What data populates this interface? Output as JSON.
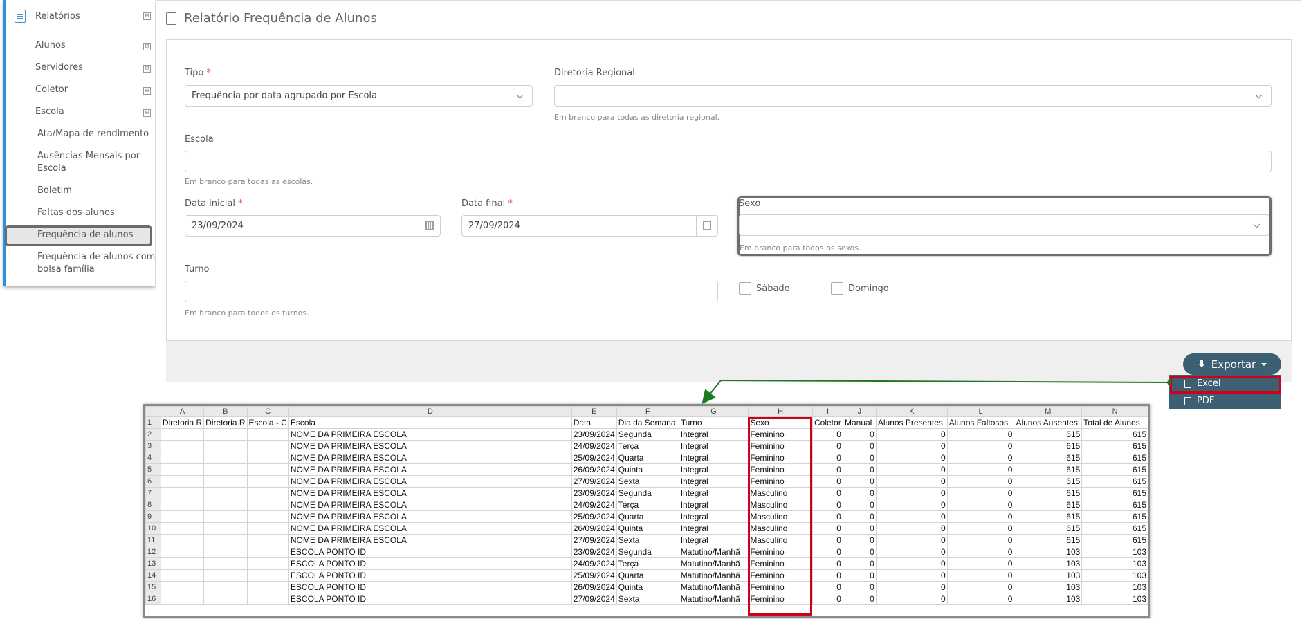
{
  "sidebar": {
    "title": "Relatórios",
    "items": [
      {
        "label": "Alunos",
        "toggle": "⊞"
      },
      {
        "label": "Servidores",
        "toggle": "⊞"
      },
      {
        "label": "Coletor",
        "toggle": "⊞"
      },
      {
        "label": "Escola",
        "toggle": "⊟"
      }
    ],
    "subitems": [
      "Ata/Mapa de rendimento",
      "Ausências Mensais por Escola",
      "Boletim",
      "Faltas dos alunos",
      "Frequência de alunos",
      "Frequência de alunos com bolsa família"
    ],
    "head_toggle": "⊟"
  },
  "page": {
    "title": "Relatório Frequência de Alunos"
  },
  "form": {
    "tipo_label": "Tipo",
    "tipo_value": "Frequência por data agrupado por Escola",
    "diretoria_label": "Diretoria Regional",
    "diretoria_hint": "Em branco para todas as diretoria regional.",
    "escola_label": "Escola",
    "escola_hint": "Em branco para todas as escolas.",
    "data_inicial_label": "Data inicial",
    "data_inicial_value": "23/09/2024",
    "data_final_label": "Data final",
    "data_final_value": "27/09/2024",
    "sexo_label": "Sexo",
    "sexo_hint": "Em branco para todos os sexos.",
    "turno_label": "Turno",
    "turno_hint": "Em branco para todos os turnos.",
    "sabado_label": "Sábado",
    "domingo_label": "Domingo",
    "required_mark": "*"
  },
  "export": {
    "button_label": "Exportar",
    "menu": [
      "Excel",
      "PDF"
    ]
  },
  "sheet": {
    "columns": [
      "A",
      "B",
      "C",
      "D",
      "E",
      "F",
      "G",
      "H",
      "I",
      "J",
      "K",
      "L",
      "M",
      "N"
    ],
    "headers": [
      "Diretoria R",
      "Diretoria R",
      "Escola - C",
      "Escola",
      "Data",
      "Dia da Semana",
      "Turno",
      "Sexo",
      "Coletor",
      "Manual",
      "Alunos Presentes",
      "Alunos Faltosos",
      "Alunos Ausentes",
      "Total de Alunos"
    ],
    "rows": [
      [
        "",
        "",
        "",
        "NOME DA PRIMEIRA ESCOLA",
        "23/09/2024",
        "Segunda",
        "Integral",
        "Feminino",
        "0",
        "0",
        "0",
        "0",
        "615",
        "615"
      ],
      [
        "",
        "",
        "",
        "NOME DA PRIMEIRA ESCOLA",
        "24/09/2024",
        "Terça",
        "Integral",
        "Feminino",
        "0",
        "0",
        "0",
        "0",
        "615",
        "615"
      ],
      [
        "",
        "",
        "",
        "NOME DA PRIMEIRA ESCOLA",
        "25/09/2024",
        "Quarta",
        "Integral",
        "Feminino",
        "0",
        "0",
        "0",
        "0",
        "615",
        "615"
      ],
      [
        "",
        "",
        "",
        "NOME DA PRIMEIRA ESCOLA",
        "26/09/2024",
        "Quinta",
        "Integral",
        "Feminino",
        "0",
        "0",
        "0",
        "0",
        "615",
        "615"
      ],
      [
        "",
        "",
        "",
        "NOME DA PRIMEIRA ESCOLA",
        "27/09/2024",
        "Sexta",
        "Integral",
        "Feminino",
        "0",
        "0",
        "0",
        "0",
        "615",
        "615"
      ],
      [
        "",
        "",
        "",
        "NOME DA PRIMEIRA ESCOLA",
        "23/09/2024",
        "Segunda",
        "Integral",
        "Masculino",
        "0",
        "0",
        "0",
        "0",
        "615",
        "615"
      ],
      [
        "",
        "",
        "",
        "NOME DA PRIMEIRA ESCOLA",
        "24/09/2024",
        "Terça",
        "Integral",
        "Masculino",
        "0",
        "0",
        "0",
        "0",
        "615",
        "615"
      ],
      [
        "",
        "",
        "",
        "NOME DA PRIMEIRA ESCOLA",
        "25/09/2024",
        "Quarta",
        "Integral",
        "Masculino",
        "0",
        "0",
        "0",
        "0",
        "615",
        "615"
      ],
      [
        "",
        "",
        "",
        "NOME DA PRIMEIRA ESCOLA",
        "26/09/2024",
        "Quinta",
        "Integral",
        "Masculino",
        "0",
        "0",
        "0",
        "0",
        "615",
        "615"
      ],
      [
        "",
        "",
        "",
        "NOME DA PRIMEIRA ESCOLA",
        "27/09/2024",
        "Sexta",
        "Integral",
        "Masculino",
        "0",
        "0",
        "0",
        "0",
        "615",
        "615"
      ],
      [
        "",
        "",
        "",
        "ESCOLA PONTO ID",
        "23/09/2024",
        "Segunda",
        "Matutino/Manhã",
        "Feminino",
        "0",
        "0",
        "0",
        "0",
        "103",
        "103"
      ],
      [
        "",
        "",
        "",
        "ESCOLA PONTO ID",
        "24/09/2024",
        "Terça",
        "Matutino/Manhã",
        "Feminino",
        "0",
        "0",
        "0",
        "0",
        "103",
        "103"
      ],
      [
        "",
        "",
        "",
        "ESCOLA PONTO ID",
        "25/09/2024",
        "Quarta",
        "Matutino/Manhã",
        "Feminino",
        "0",
        "0",
        "0",
        "0",
        "103",
        "103"
      ],
      [
        "",
        "",
        "",
        "ESCOLA PONTO ID",
        "26/09/2024",
        "Quinta",
        "Matutino/Manhã",
        "Feminino",
        "0",
        "0",
        "0",
        "0",
        "103",
        "103"
      ],
      [
        "",
        "",
        "",
        "ESCOLA PONTO ID",
        "27/09/2024",
        "Sexta",
        "Matutino/Manhã",
        "Feminino",
        "0",
        "0",
        "0",
        "0",
        "103",
        "103"
      ]
    ]
  },
  "colors": {
    "accent": "#2f8fd8",
    "export": "#3d5f72",
    "highlight": "#d0001a",
    "arrow": "#1e7a1e"
  }
}
